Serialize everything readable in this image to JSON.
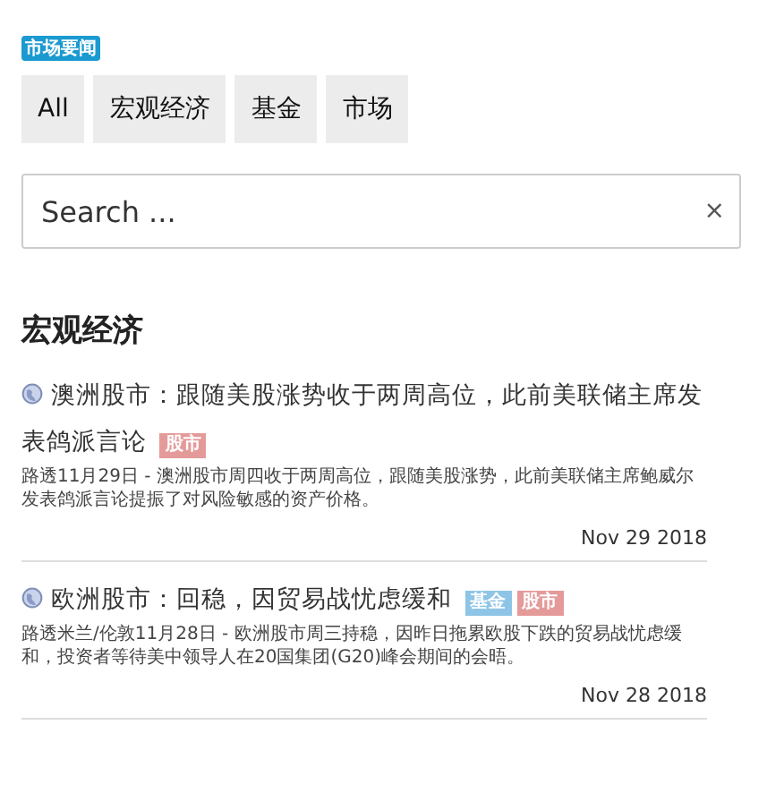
{
  "badge": "市场要闻",
  "tabs": [
    {
      "label": "All",
      "selected": false
    },
    {
      "label": "宏观经济",
      "selected": false
    },
    {
      "label": "基金",
      "selected": false
    },
    {
      "label": "市场",
      "selected": false
    }
  ],
  "search": {
    "placeholder": "Search ...",
    "clear": "×"
  },
  "section_title": "宏观经济",
  "articles": [
    {
      "title": "澳洲股市：跟随美股涨势收于两周高位，此前美联储主席发表鸽派言论",
      "tags": [
        {
          "label": "股市",
          "color": "#e59a9a"
        }
      ],
      "summary": "路透11月29日 - 澳洲股市周四收于两周高位，跟随美股涨势，此前美联储主席鲍威尔发表鸽派言论提振了对风险敏感的资产价格。",
      "date": "Nov 29 2018"
    },
    {
      "title": "欧洲股市：回稳，因贸易战忧虑缓和",
      "tags": [
        {
          "label": "基金",
          "color": "#8ec4e6"
        },
        {
          "label": "股市",
          "color": "#e59a9a"
        }
      ],
      "summary": "路透米兰/伦敦11月28日 - 欧洲股市周三持稳，因昨日拖累欧股下跌的贸易战忧虑缓和，投资者等待美中领导人在20国集团(G20)峰会期间的会晤。",
      "date": "Nov 28 2018"
    }
  ]
}
